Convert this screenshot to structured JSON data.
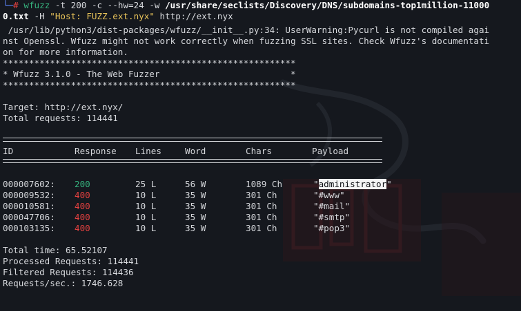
{
  "prompt": {
    "corner": "└─",
    "hash": "#",
    "command": "wfuzz",
    "arg1": " -t 200 -c --hw=24 -w ",
    "wordlist_a": "/usr/share/seclists/Discovery/DNS/subdomains-top1million-11000",
    "wordlist_b": "0.txt",
    "arg2": " -H ",
    "header": "\"Host: FUZZ.ext.nyx\"",
    "url": " http://ext.nyx"
  },
  "warning": [
    " /usr/lib/python3/dist-packages/wfuzz/__init__.py:34: UserWarning:Pycurl is not compiled agai",
    "nst Openssl. Wfuzz might not work correctly when fuzzing SSL sites. Check Wfuzz's documentati",
    "on for more information."
  ],
  "banner": {
    "stars": "********************************************************",
    "title": "* Wfuzz 3.1.0 - The Web Fuzzer                         *"
  },
  "target_line": "Target: http://ext.nyx/",
  "total_requests_line": "Total requests: 114441",
  "table": {
    "headers": [
      "ID",
      "Response",
      "Lines",
      "Word",
      "Chars",
      "Payload"
    ],
    "rows": [
      {
        "id": "000007602:",
        "response": "200",
        "lines": "25 L",
        "word": "56 W",
        "chars": "1089 Ch",
        "payload_open": "\"",
        "payload": "administrator",
        "payload_close": "\"",
        "selected": true
      },
      {
        "id": "000009532:",
        "response": "400",
        "lines": "10 L",
        "word": "35 W",
        "chars": "301 Ch",
        "payload_open": "\"",
        "payload": "#www",
        "payload_close": "\"",
        "selected": false
      },
      {
        "id": "000010581:",
        "response": "400",
        "lines": "10 L",
        "word": "35 W",
        "chars": "301 Ch",
        "payload_open": "\"",
        "payload": "#mail",
        "payload_close": "\"",
        "selected": false
      },
      {
        "id": "000047706:",
        "response": "400",
        "lines": "10 L",
        "word": "35 W",
        "chars": "301 Ch",
        "payload_open": "\"",
        "payload": "#smtp",
        "payload_close": "\"",
        "selected": false
      },
      {
        "id": "000103135:",
        "response": "400",
        "lines": "10 L",
        "word": "35 W",
        "chars": "301 Ch",
        "payload_open": "\"",
        "payload": "#pop3",
        "payload_close": "\"",
        "selected": false
      }
    ]
  },
  "summary": [
    "Total time: 65.52107",
    "Processed Requests: 114441",
    "Filtered Requests: 114436",
    "Requests/sec.: 1746.628"
  ],
  "colors": {
    "background": "#15181e",
    "text": "#d6d8dc",
    "prompt_blue": "#5f87ff",
    "status_ok": "#36b37e",
    "status_error": "#e2403f",
    "string_yellow": "#e8c35a"
  }
}
